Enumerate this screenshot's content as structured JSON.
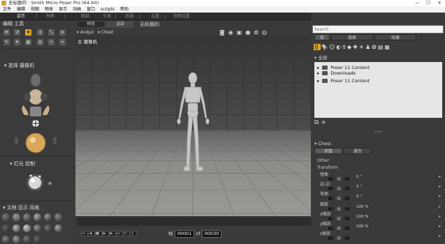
{
  "window": {
    "title": "无标题的 - Smith Micro Poser Pro  (64-bit)",
    "controls": [
      "—",
      "☐",
      "✕"
    ]
  },
  "menu": [
    "文件",
    "编辑",
    "视图",
    "物体",
    "显示",
    "动画",
    "窗口",
    "scripts",
    "帮助"
  ],
  "rooms": [
    "姿势",
    "材质",
    "面部",
    "头发",
    "衣服",
    "设置",
    "货物设置"
  ],
  "left": {
    "editing_tools_title": "编辑 工具",
    "camera_title": "选择 摄像机",
    "light_title": "灯光 控制",
    "display_style_title": "文档 显示 风格"
  },
  "viewport": {
    "tabs": [
      "预览",
      "渲染"
    ],
    "doc_title": "无标题的",
    "figure_menu": "Andy2",
    "actor_menu": "Chest",
    "camera_label": "主 摄像机",
    "frame_label": "帧",
    "frame_current": "00001",
    "frame_of": "of",
    "frame_total": "00030"
  },
  "library": {
    "search_placeholder": "Search",
    "tabs": [
      "库",
      "搜索",
      "收藏"
    ],
    "category": "全部",
    "tree": [
      "Poser 11 Content",
      "Downloads",
      "Poser 11 Content"
    ]
  },
  "params": {
    "actor": "Chest",
    "tabs": [
      "参数",
      "属性"
    ],
    "groups": [
      "Other",
      "Transform"
    ],
    "rows": [
      {
        "label": "扭曲",
        "value": "0 °"
      },
      {
        "label": "边-边",
        "value": "0 °"
      },
      {
        "label": "弯曲",
        "value": "0 °"
      },
      {
        "label": "缩放",
        "value": "100 %"
      },
      {
        "label": "x缩放",
        "value": "100 %"
      },
      {
        "label": "y缩放",
        "value": "100 %"
      },
      {
        "label": "z缩放",
        "value": ""
      }
    ]
  },
  "colors": {
    "accent": "#d9a520",
    "floor": "#8a8a86",
    "wall": "#3d3e3d"
  }
}
